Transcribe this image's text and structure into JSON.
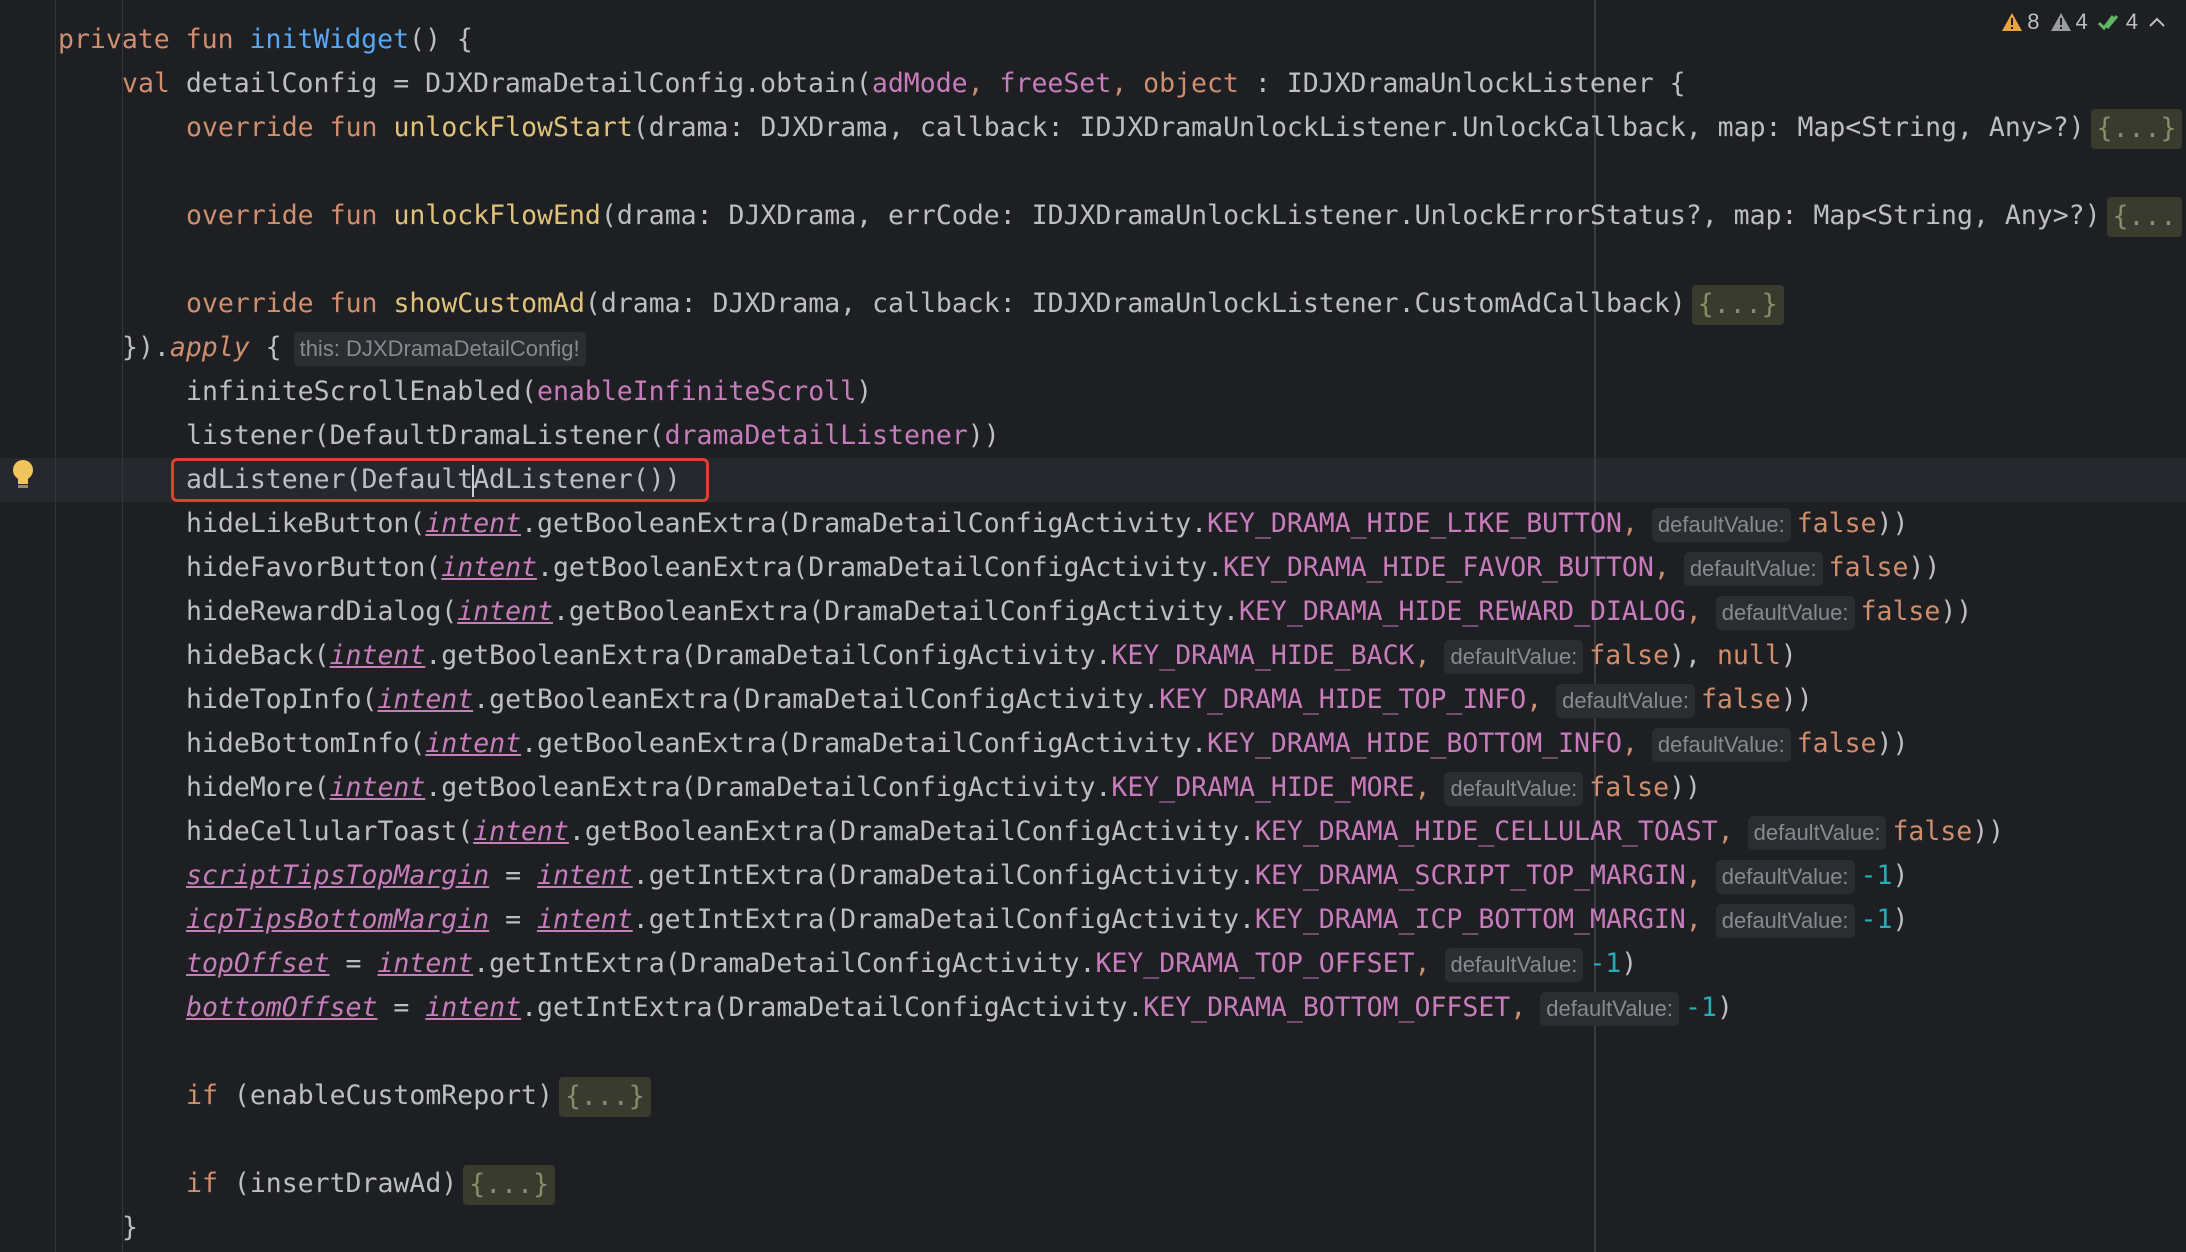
{
  "status_bar": {
    "errors_count": "8",
    "warnings_count": "4",
    "ok_count": "4"
  },
  "hint_this": "this: DJXDramaDetailConfig!",
  "hint_default_value": "defaultValue:",
  "fold_placeholder": "{...}",
  "fold_placeholder_cut": "{...",
  "fold_placeholder_cut2": "{...}",
  "code": {
    "l1_private": "private",
    "l1_fun": "fun",
    "l1_name": "initWidget",
    "l1_rest": "() {",
    "l2_val": "val",
    "l2_text1": " detailConfig = DJXDramaDetailConfig.obtain(",
    "l2_admode": "adMode",
    "l2_comma1": ", ",
    "l2_freeset": "freeSet",
    "l2_comma2": ", ",
    "l2_object": "object",
    "l2_text2": " : IDJXDramaUnlockListener {",
    "l3_override": "override",
    "l3_fun": "fun",
    "l3_name": "unlockFlowStart",
    "l3_text": "(drama: DJXDrama, callback: IDJXDramaUnlockListener.UnlockCallback, map: Map<String, Any>?)",
    "l5_override": "override",
    "l5_fun": "fun",
    "l5_name": "unlockFlowEnd",
    "l5_text": "(drama: DJXDrama, errCode: IDJXDramaUnlockListener.UnlockErrorStatus?, map: Map<String, Any>?)",
    "l7_override": "override",
    "l7_fun": "fun",
    "l7_name": "showCustomAd",
    "l7_text": "(drama: DJXDrama, callback: IDJXDramaUnlockListener.CustomAdCallback)",
    "l8_close": "}).",
    "l8_apply": "apply",
    "l8_brace": " {",
    "l9_fn": "infiniteScrollEnabled(",
    "l9_arg": "enableInfiniteScroll",
    "l9_close": ")",
    "l10_fn": "listener(DefaultDramaListener(",
    "l10_arg": "dramaDetailListener",
    "l10_close": "))",
    "l11_a": "adListener(Default",
    "l11_b": "AdListener())",
    "intent": "intent",
    "get_bool": ".getBooleanExtra(DramaDetailConfigActivity.",
    "get_int": ".getIntExtra(DramaDetailConfigActivity.",
    "false": "false",
    "minus_one": "-1",
    "l12_fn": "hideLikeButton(",
    "l12_key": "KEY_DRAMA_HIDE_LIKE_BUTTON",
    "l13_fn": "hideFavorButton(",
    "l13_key": "KEY_DRAMA_HIDE_FAVOR_BUTTON",
    "l14_fn": "hideRewardDialog(",
    "l14_key": "KEY_DRAMA_HIDE_REWARD_DIALOG",
    "l15_fn": "hideBack(",
    "l15_key": "KEY_DRAMA_HIDE_BACK",
    "l15_null": "null",
    "l16_fn": "hideTopInfo(",
    "l16_key": "KEY_DRAMA_HIDE_TOP_INFO",
    "l17_fn": "hideBottomInfo(",
    "l17_key": "KEY_DRAMA_HIDE_BOTTOM_INFO",
    "l18_fn": "hideMore(",
    "l18_key": "KEY_DRAMA_HIDE_MORE",
    "l19_fn": "hideCellularToast(",
    "l19_key": "KEY_DRAMA_HIDE_CELLULAR_TOAST",
    "l20_prop": "scriptTipsTopMargin",
    "l20_key": "KEY_DRAMA_SCRIPT_TOP_MARGIN",
    "l21_prop": "icpTipsBottomMargin",
    "l21_key": "KEY_DRAMA_ICP_BOTTOM_MARGIN",
    "l22_prop": "topOffset",
    "l22_key": "KEY_DRAMA_TOP_OFFSET",
    "l23_prop": "bottomOffset",
    "l23_key": "KEY_DRAMA_BOTTOM_OFFSET",
    "eq": " = ",
    "comma": ",",
    "close1": ")",
    "close2": "))",
    "close_null": "), ",
    "l25_if": "if",
    "l25_cond": " (enableCustomReport)",
    "l27_if": "if",
    "l27_cond": " (insertDrawAd)",
    "l28_close": "}"
  }
}
